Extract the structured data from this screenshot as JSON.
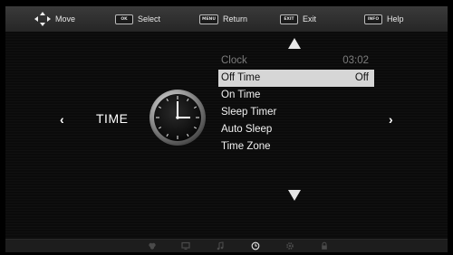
{
  "hints": [
    {
      "key": "",
      "label": "Move",
      "icon": "dpad-icon"
    },
    {
      "key": "OK",
      "label": "Select"
    },
    {
      "key": "MENU",
      "label": "Return"
    },
    {
      "key": "EXIT",
      "label": "Exit"
    },
    {
      "key": "INFO",
      "label": "Help"
    }
  ],
  "page": {
    "title": "TIME",
    "left_arrow": "‹",
    "right_arrow": "›"
  },
  "menu": {
    "items": [
      {
        "label": "Clock",
        "value": "03:02",
        "state": "disabled"
      },
      {
        "label": "Off Time",
        "value": "Off",
        "state": "selected"
      },
      {
        "label": "On Time",
        "value": "",
        "state": "normal"
      },
      {
        "label": "Sleep Timer",
        "value": "",
        "state": "normal"
      },
      {
        "label": "Auto Sleep",
        "value": "",
        "state": "normal"
      },
      {
        "label": "Time Zone",
        "value": "",
        "state": "normal"
      }
    ]
  },
  "bottom_tabs": [
    {
      "icon": "picture-icon",
      "active": false
    },
    {
      "icon": "screen-icon",
      "active": false
    },
    {
      "icon": "music-note-icon",
      "active": false
    },
    {
      "icon": "clock-icon",
      "active": true
    },
    {
      "icon": "gear-icon",
      "active": false
    },
    {
      "icon": "lock-icon",
      "active": false
    }
  ],
  "colors": {
    "highlight": "#d6d6d6",
    "disabled_text": "#7c7c7c",
    "background": "#0b0b0b"
  }
}
